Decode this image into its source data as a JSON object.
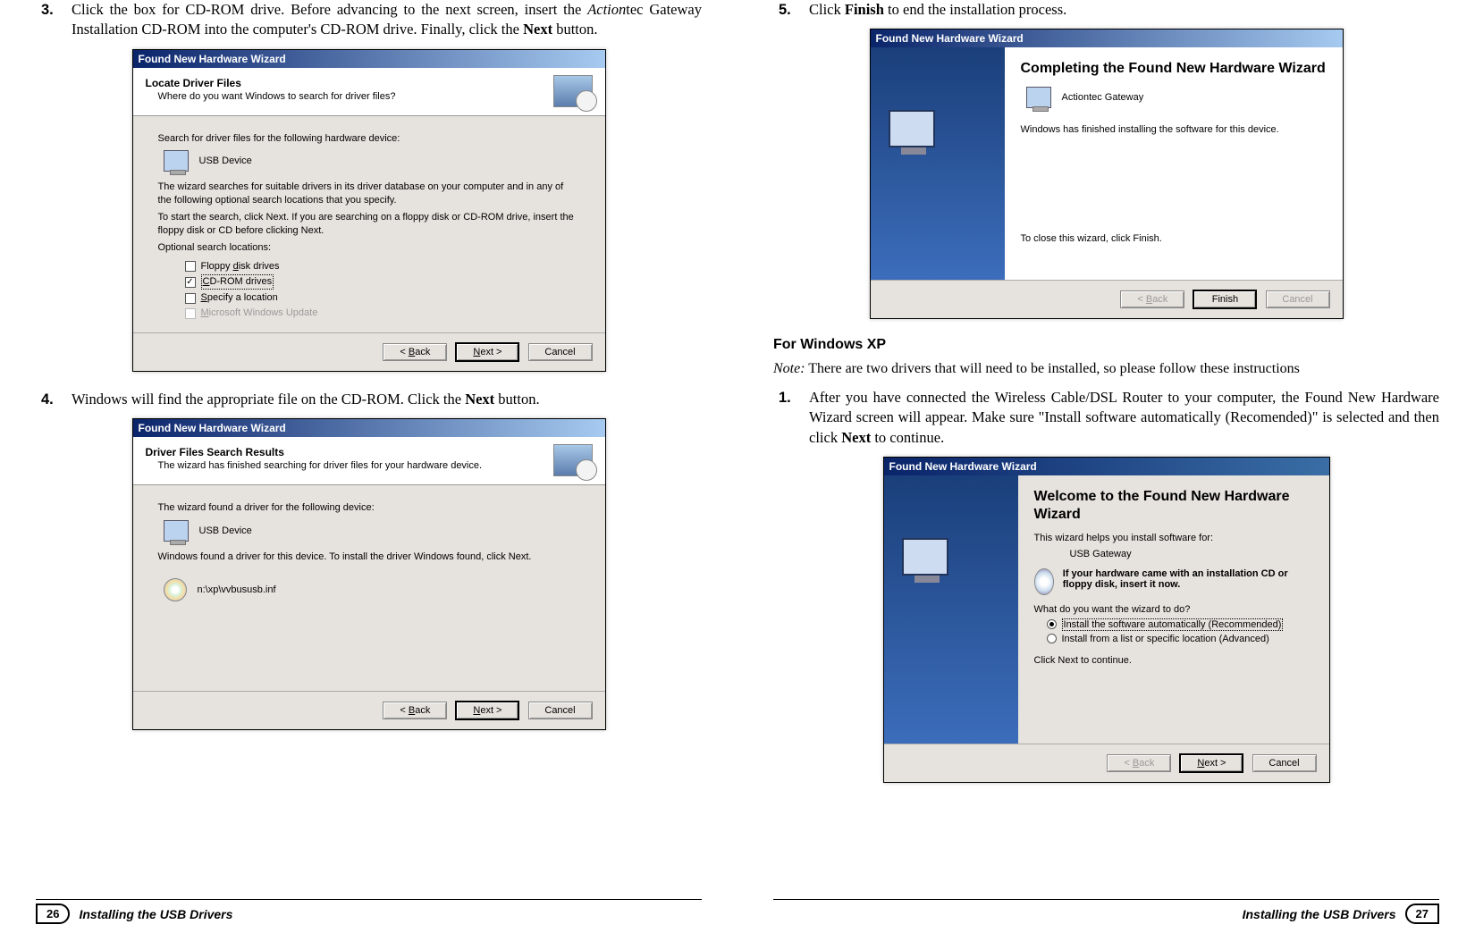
{
  "left": {
    "step3": {
      "num": "3.",
      "text_pre": "Click the box for CD-ROM drive. Before advancing to the next screen, insert the ",
      "text_italic": "Action",
      "text_mid": "tec Gateway Installation CD-ROM into the computer's CD-ROM drive. Finally, click the ",
      "text_bold": "Next",
      "text_post": " button."
    },
    "wiz3": {
      "title": "Found New Hardware Wizard",
      "header_title": "Locate Driver Files",
      "header_sub": "Where do you want Windows to search for driver files?",
      "body_line1": "Search for driver files for the following hardware device:",
      "device": "USB Device",
      "body_para1": "The wizard searches for suitable drivers in its driver database on your computer and in any of the following optional search locations that you specify.",
      "body_para2": "To start the search, click Next. If you are searching on a floppy disk or CD-ROM drive, insert the floppy disk or CD before clicking Next.",
      "opt_label": "Optional search locations:",
      "chk_floppy": "Floppy disk drives",
      "chk_cdrom": "CD-ROM drives",
      "chk_specify": "Specify a location",
      "chk_update": "Microsoft Windows Update",
      "btn_back": "< Back",
      "btn_next": "Next >",
      "btn_cancel": "Cancel"
    },
    "step4": {
      "num": "4.",
      "text_pre": "Windows will find the appropriate file on the CD-ROM. Click the ",
      "text_bold": "Next",
      "text_post": " button."
    },
    "wiz4": {
      "title": "Found New Hardware Wizard",
      "header_title": "Driver Files Search Results",
      "header_sub": "The wizard has finished searching for driver files for your hardware device.",
      "body_line1": "The wizard found a driver for the following device:",
      "device": "USB Device",
      "body_para1": "Windows found a driver for this device. To install the driver Windows found, click Next.",
      "path": "n:\\xp\\vvbususb.inf",
      "btn_back": "< Back",
      "btn_next": "Next >",
      "btn_cancel": "Cancel"
    }
  },
  "right": {
    "step5": {
      "num": "5.",
      "text_pre": "Click ",
      "text_bold": "Finish",
      "text_post": " to end the installation process."
    },
    "wiz5": {
      "title": "Found New Hardware Wizard",
      "big_title": "Completing the Found New Hardware Wizard",
      "device": "Actiontec Gateway",
      "finished": "Windows has finished installing the software for this device.",
      "close_line": "To close this wizard, click Finish.",
      "btn_back": "< Back",
      "btn_finish": "Finish",
      "btn_cancel": "Cancel"
    },
    "xp_heading": "For Windows XP",
    "xp_note_label": "Note:",
    "xp_note_text": " There are two drivers that will need to be installed, so please follow these instructions",
    "step1": {
      "num": "1.",
      "text_pre": "After you have connected the Wireless Cable/DSL Router to your computer, the Found New Hardware Wizard screen will appear. Make sure \"Install software automatically (Recomended)\" is selected and then click ",
      "text_bold": "Next",
      "text_post": " to continue."
    },
    "wizxp": {
      "title": "Found New Hardware Wizard",
      "big_title": "Welcome to the Found New Hardware Wizard",
      "helps": "This wizard helps you install software for:",
      "device": "USB Gateway",
      "cd_line": "If your hardware came with an installation CD or floppy disk, insert it now.",
      "what": "What do you want the wizard to do?",
      "radio_auto": "Install the software automatically (Recommended)",
      "radio_list": "Install from a list or specific location (Advanced)",
      "click_next": "Click Next to continue.",
      "btn_back": "< Back",
      "btn_next": "Next >",
      "btn_cancel": "Cancel"
    }
  },
  "footer": {
    "left_num": "26",
    "right_num": "27",
    "title": "Installing the USB Drivers"
  }
}
